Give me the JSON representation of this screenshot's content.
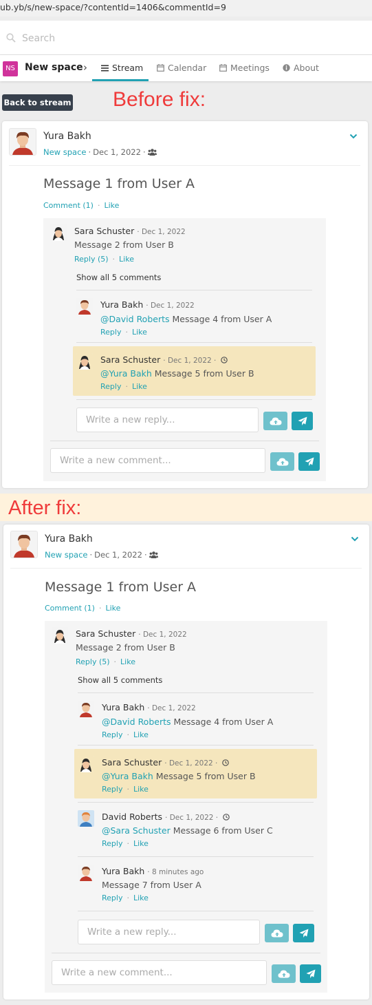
{
  "browser": {
    "url": "ub.yb/s/new-space/?contentId=1406&commentId=9"
  },
  "search": {
    "placeholder": "Search"
  },
  "nav": {
    "badge": "NS",
    "space_name": "New space",
    "crumb": "›",
    "tabs": [
      {
        "label": "Stream",
        "icon": "list-icon",
        "active": true
      },
      {
        "label": "Calendar",
        "icon": "calendar-icon"
      },
      {
        "label": "Meetings",
        "icon": "meetings-icon"
      },
      {
        "label": "About",
        "icon": "info-icon"
      }
    ]
  },
  "back_button": "Back to stream",
  "annotations": {
    "before": "Before fix:",
    "after": "After fix:"
  },
  "colors": {
    "accent": "#21a1b3",
    "highlight": "#f5e6bd",
    "annotation": "#ef3b3b",
    "dark_button": "#37404c",
    "badge": "#d0339b"
  },
  "before": {
    "post": {
      "author": "Yura Bakh",
      "space_link": "New space",
      "sep": "·",
      "date": "Dec 1, 2022",
      "visibility_icon": "users-icon",
      "message": "Message 1 from User A",
      "comment_link": "Comment (1)",
      "like": "Like"
    },
    "comment": {
      "author": "Sara Schuster",
      "date": "· Dec 1, 2022",
      "text": "Message 2 from User B",
      "reply": "Reply (5)",
      "like": "Like"
    },
    "show_all": "Show all 5 comments",
    "replies": [
      {
        "author": "Yura Bakh",
        "date": "· Dec 1, 2022",
        "mention": "@David Roberts",
        "text": " Message 4 from User A",
        "reply": "Reply",
        "like": "Like"
      },
      {
        "author": "Sara Schuster",
        "date": "· Dec 1, 2022 ·",
        "mention": "@Yura Bakh",
        "text": " Message 5 from User B",
        "reply": "Reply",
        "like": "Like",
        "highlighted": true
      }
    ],
    "reply_placeholder": "Write a new reply...",
    "comment_placeholder": "Write a new comment..."
  },
  "after": {
    "post": {
      "author": "Yura Bakh",
      "space_link": "New space",
      "sep": "·",
      "date": "Dec 1, 2022",
      "visibility_icon": "users-icon",
      "message": "Message 1 from User A",
      "comment_link": "Comment (1)",
      "like": "Like"
    },
    "comment": {
      "author": "Sara Schuster",
      "date": "· Dec 1, 2022",
      "text": "Message 2 from User B",
      "reply": "Reply (5)",
      "like": "Like"
    },
    "show_all": "Show all 5 comments",
    "replies": [
      {
        "author": "Yura Bakh",
        "date": "· Dec 1, 2022",
        "mention": "@David Roberts",
        "text": " Message 4 from User A",
        "reply": "Reply",
        "like": "Like"
      },
      {
        "author": "Sara Schuster",
        "date": "· Dec 1, 2022 ·",
        "mention": "@Yura Bakh",
        "text": " Message 5 from User B",
        "reply": "Reply",
        "like": "Like",
        "highlighted": true
      },
      {
        "author": "David Roberts",
        "date": "· Dec 1, 2022 ·",
        "mention": "@Sara Schuster",
        "text": " Message 6 from User C",
        "reply": "Reply",
        "like": "Like"
      },
      {
        "author": "Yura Bakh",
        "date": "· 8 minutes ago",
        "mention": "",
        "text": "Message 7 from User A",
        "reply": "Reply",
        "like": "Like"
      }
    ],
    "reply_placeholder": "Write a new reply...",
    "comment_placeholder": "Write a new comment..."
  }
}
